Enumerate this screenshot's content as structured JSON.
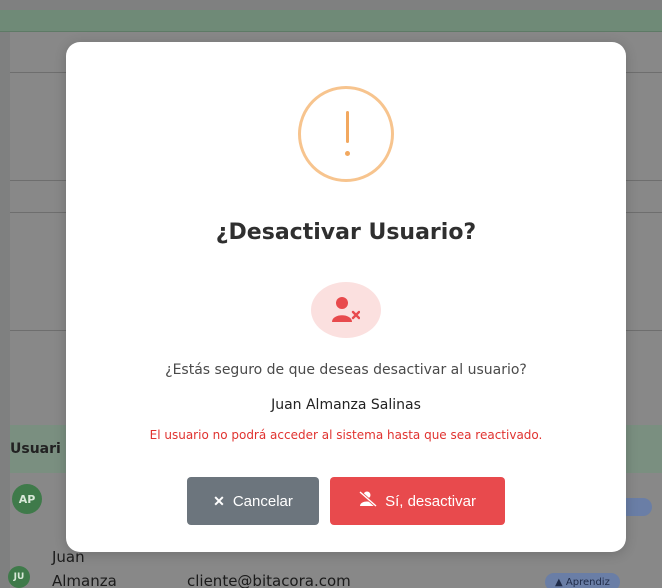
{
  "background": {
    "table_header": "Usuari",
    "rows": [
      {
        "avatar": "AP"
      },
      {
        "avatar": "JU",
        "name_line1": "Juan",
        "name_line2": "Almanza",
        "email": "cliente@bitacora.com",
        "role": "Aprendiz"
      }
    ]
  },
  "modal": {
    "title": "¿Desactivar Usuario?",
    "question": "¿Estás seguro de que deseas desactivar al usuario?",
    "user_name": "Juan Almanza Salinas",
    "warning": "El usuario no podrá acceder al sistema hasta que sea reactivado.",
    "cancel_label": "Cancelar",
    "confirm_label": "Sí, desactivar",
    "icons": {
      "alert": "exclamation-circle-icon",
      "badge": "user-remove-icon",
      "cancel": "close-icon",
      "confirm": "user-slash-icon"
    },
    "colors": {
      "alert": "#f7c48e",
      "danger": "#e84a4d",
      "secondary": "#6c757d"
    }
  }
}
